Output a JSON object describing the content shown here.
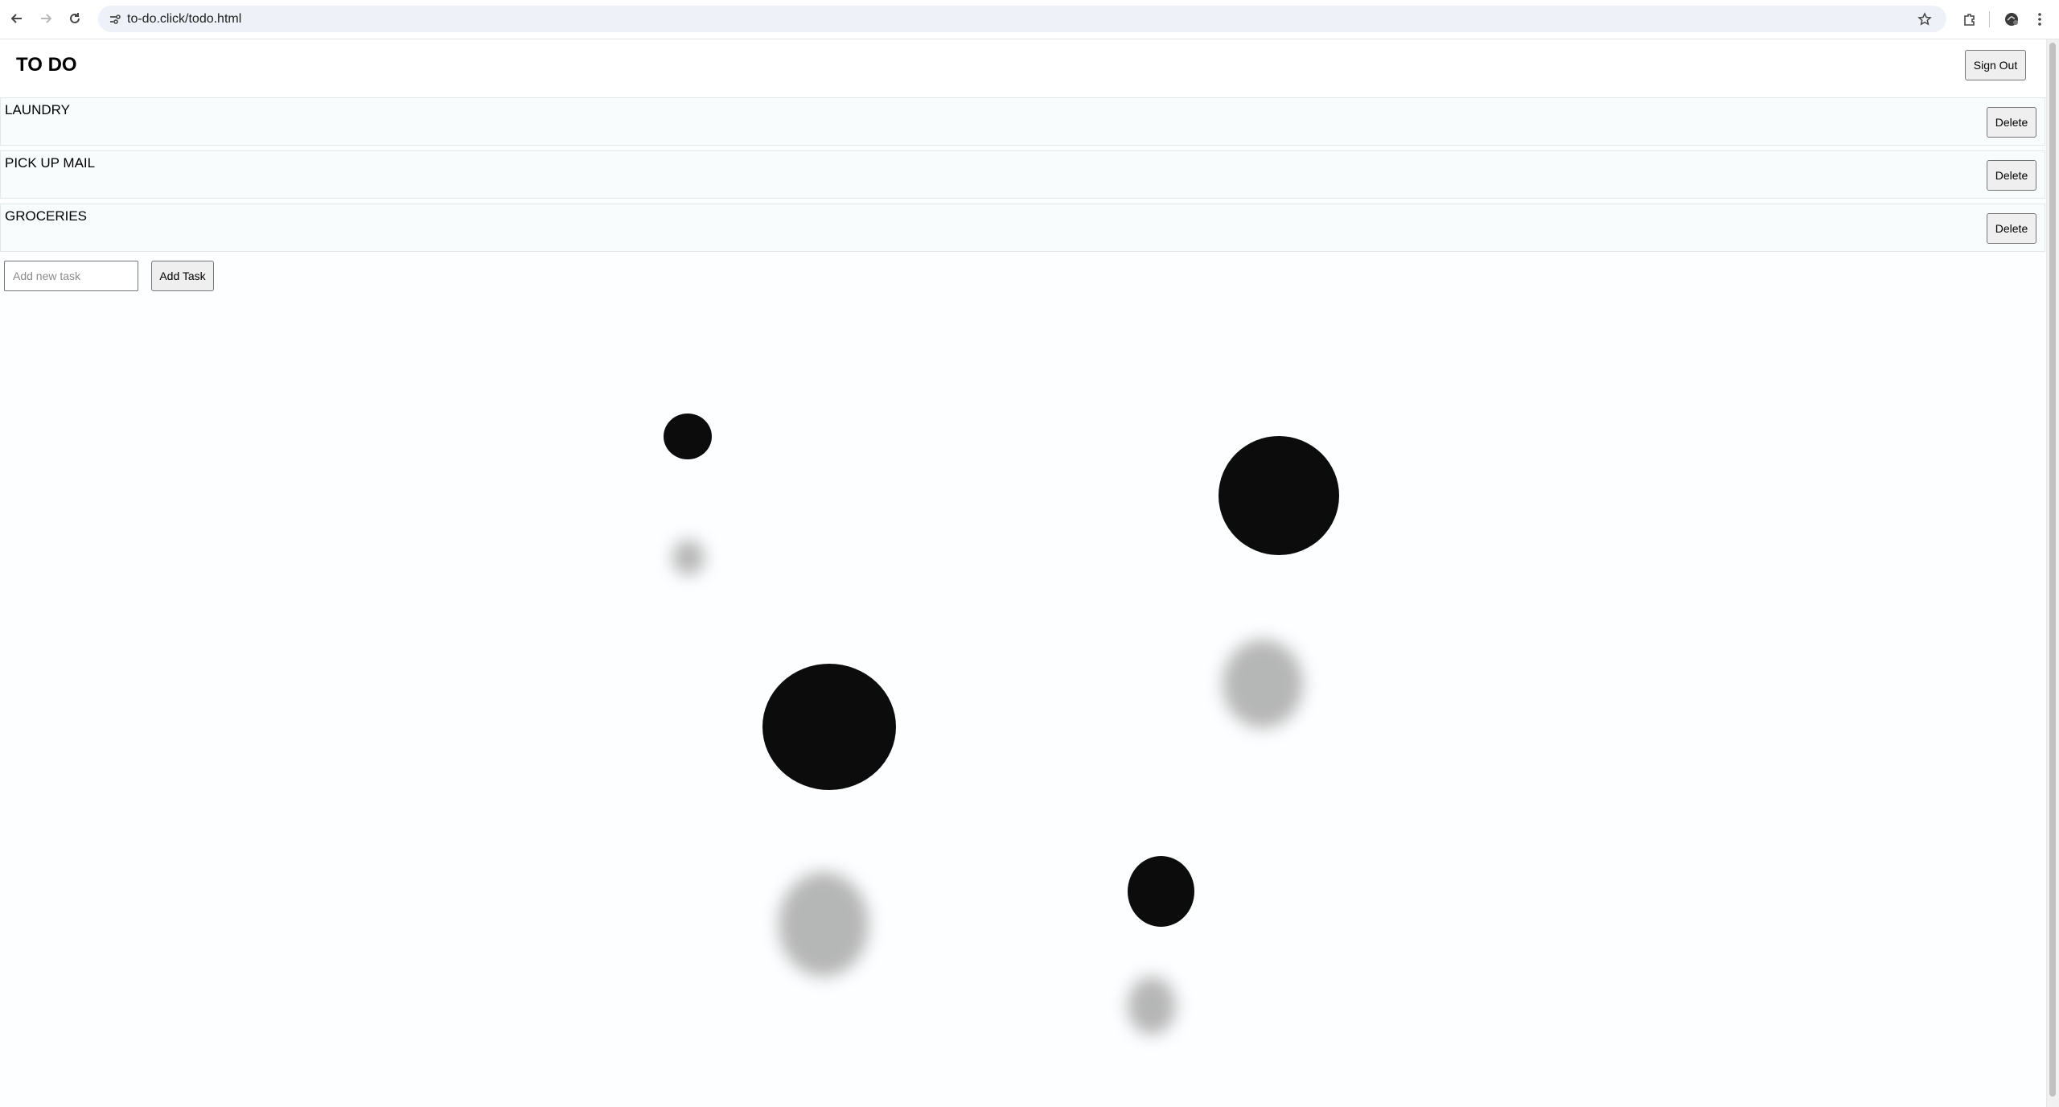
{
  "browser": {
    "url": "to-do.click/todo.html",
    "icons": [
      "back-arrow-icon",
      "forward-arrow-icon",
      "reload-icon",
      "site-settings-icon",
      "bookmark-star-icon",
      "extensions-icon",
      "profile-icon",
      "kebab-menu-icon"
    ]
  },
  "app": {
    "title": "TO DO",
    "sign_out_label": "Sign Out"
  },
  "tasks": [
    {
      "text": "LAUNDRY",
      "delete_label": "Delete"
    },
    {
      "text": "PICK UP MAIL",
      "delete_label": "Delete"
    },
    {
      "text": "GROCERIES",
      "delete_label": "Delete"
    }
  ],
  "new_task": {
    "placeholder": "Add new task",
    "value": "",
    "add_label": "Add Task"
  },
  "colors": {
    "background": "#fdfeff",
    "row_background": "#f8fcfc",
    "dots": "#0c0c0c",
    "shadows": "#9e9e9e"
  }
}
